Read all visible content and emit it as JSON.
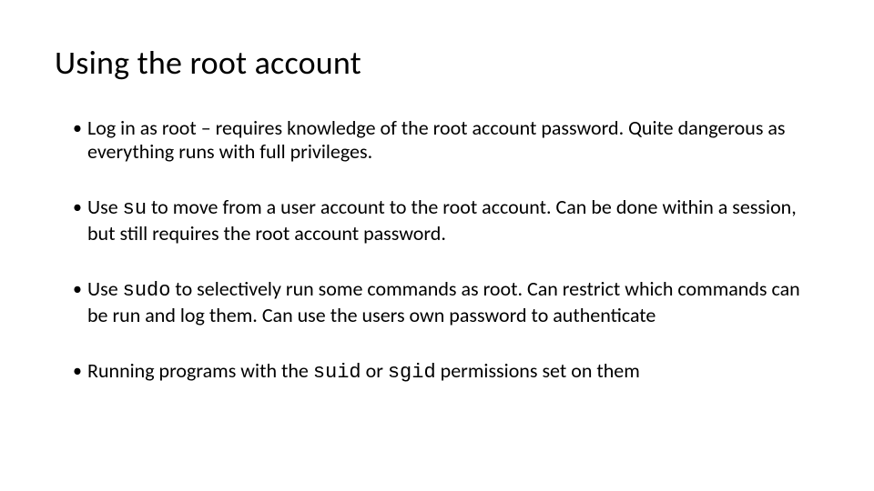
{
  "slide": {
    "title": "Using the root account",
    "bullets": [
      {
        "text_a": "Log in as root – requires knowledge of the root account password. Quite dangerous as everything runs with full privileges."
      },
      {
        "text_a": "Use ",
        "code_a": "su",
        "text_b": " to move from a user account to the root account. Can be done within a session, but still requires the root account password."
      },
      {
        "text_a": "Use ",
        "code_a": "sudo",
        "text_b": " to selectively run some commands as root. Can restrict which commands can be run and log them.  Can use the users own password to authenticate"
      },
      {
        "text_a": "Running programs with the ",
        "code_a": "suid",
        "text_b": " or ",
        "code_b": "sgid",
        "text_c": " permissions set on them"
      }
    ]
  }
}
